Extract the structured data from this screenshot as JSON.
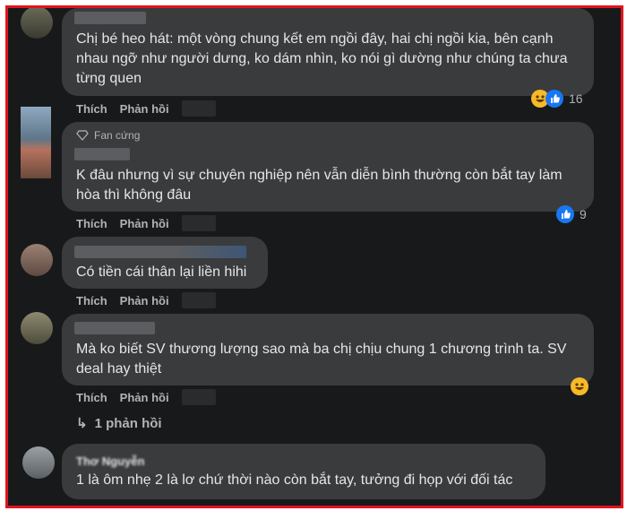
{
  "comments": [
    {
      "text": "Chị bé heo hát: một vòng chung kết em ngồi đây, hai chị ngồi kia, bên cạnh nhau ngỡ như người dưng, ko dám nhìn, ko nói gì dường như chúng ta chưa từng quen",
      "like_label": "Thích",
      "reply_label": "Phản hồi",
      "reaction_count": "16"
    },
    {
      "badge": "Fan cứng",
      "text": "K đâu nhưng vì sự chuyên nghiệp nên vẫn diễn bình thường còn bắt tay làm hòa thì không đâu",
      "like_label": "Thích",
      "reply_label": "Phản hồi",
      "reaction_count": "9"
    },
    {
      "text": "Có tiền cái thân lại liền hihi",
      "like_label": "Thích",
      "reply_label": "Phản hồi"
    },
    {
      "text": "Mà ko biết SV thương lượng sao mà ba chị chịu chung 1 chương trình ta. SV deal hay thiệt",
      "like_label": "Thích",
      "reply_label": "Phản hồi",
      "replies_link": "1 phản hồi"
    },
    {
      "author": "Thơ Nguyễn",
      "text": "1 là ôm nhẹ 2 là lơ chứ thời nào còn bắt tay, tưởng đi họp với đối tác"
    }
  ],
  "colors": {
    "background": "#18191a",
    "bubble": "#3a3b3c",
    "text": "#e4e6eb",
    "muted": "#b0b3b8",
    "frame": "#e0141e",
    "like": "#1877f2",
    "haha": "#f7b928"
  }
}
